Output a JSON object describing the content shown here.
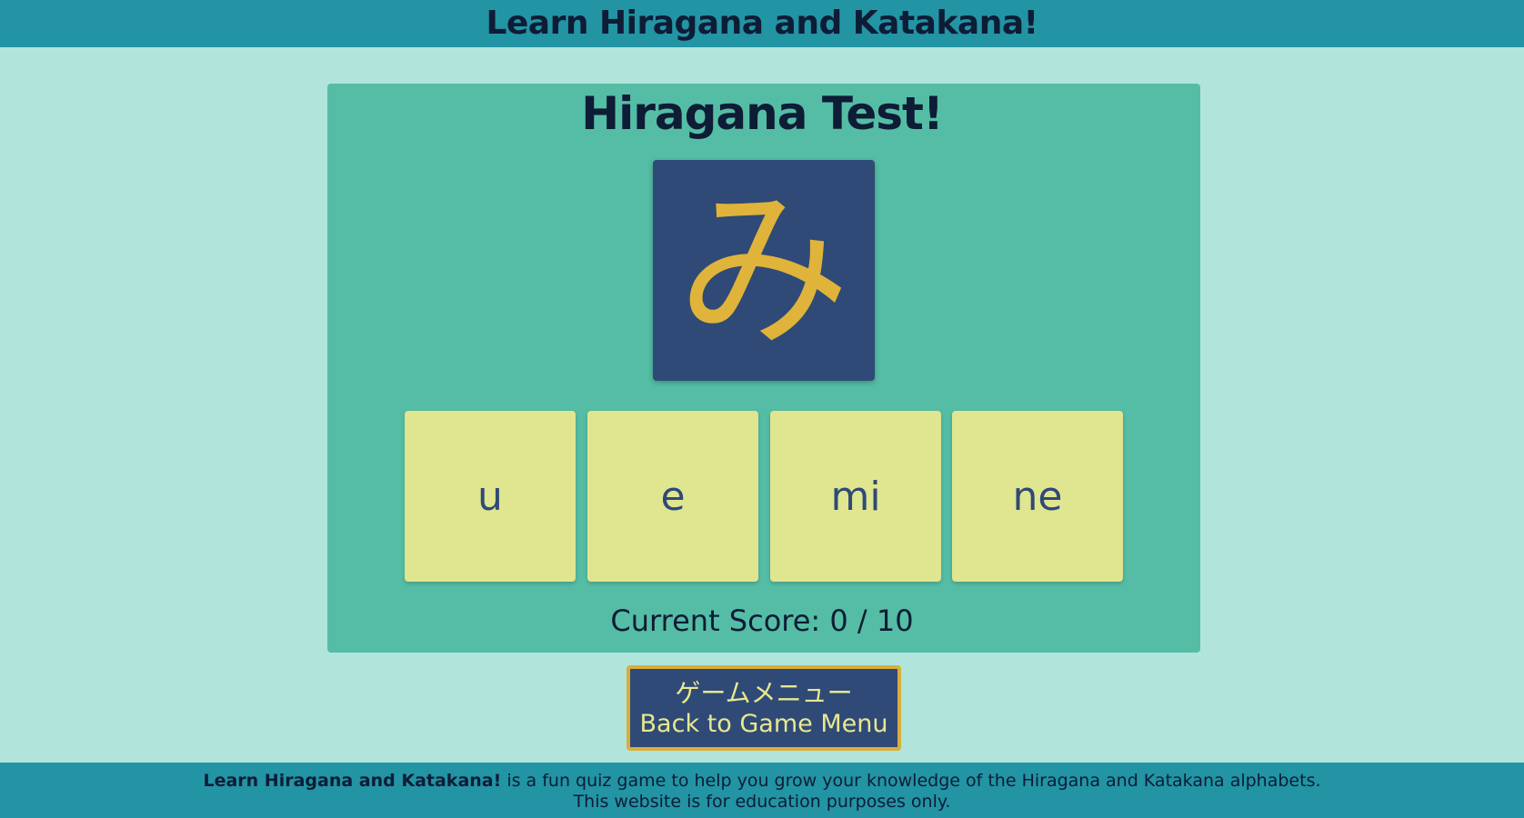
{
  "header": {
    "site_title": "Learn Hiragana and Katakana!"
  },
  "game": {
    "title": "Hiragana Test!",
    "kana": "み",
    "choices": [
      "u",
      "e",
      "mi",
      "ne"
    ],
    "score_label": "Current Score:",
    "score_current": "0",
    "score_separator": "/",
    "score_total": "10"
  },
  "menu_button": {
    "label_jp": "ゲームメニュー",
    "label_en": "Back to Game Menu"
  },
  "footer": {
    "brand": "Learn Hiragana and Katakana!",
    "tagline": " is a fun quiz game to help you grow your knowledge of the Hiragana and Katakana alphabets.",
    "disclaimer": "This website is for education purposes only."
  },
  "colors": {
    "header_bg": "#2294a4",
    "page_bg": "#b1e5dc",
    "panel_bg": "#55bda5",
    "kana_card_bg": "#2f4a77",
    "kana_color": "#e0b33a",
    "choice_bg": "#e0e590",
    "button_border": "#d9ae3b"
  }
}
